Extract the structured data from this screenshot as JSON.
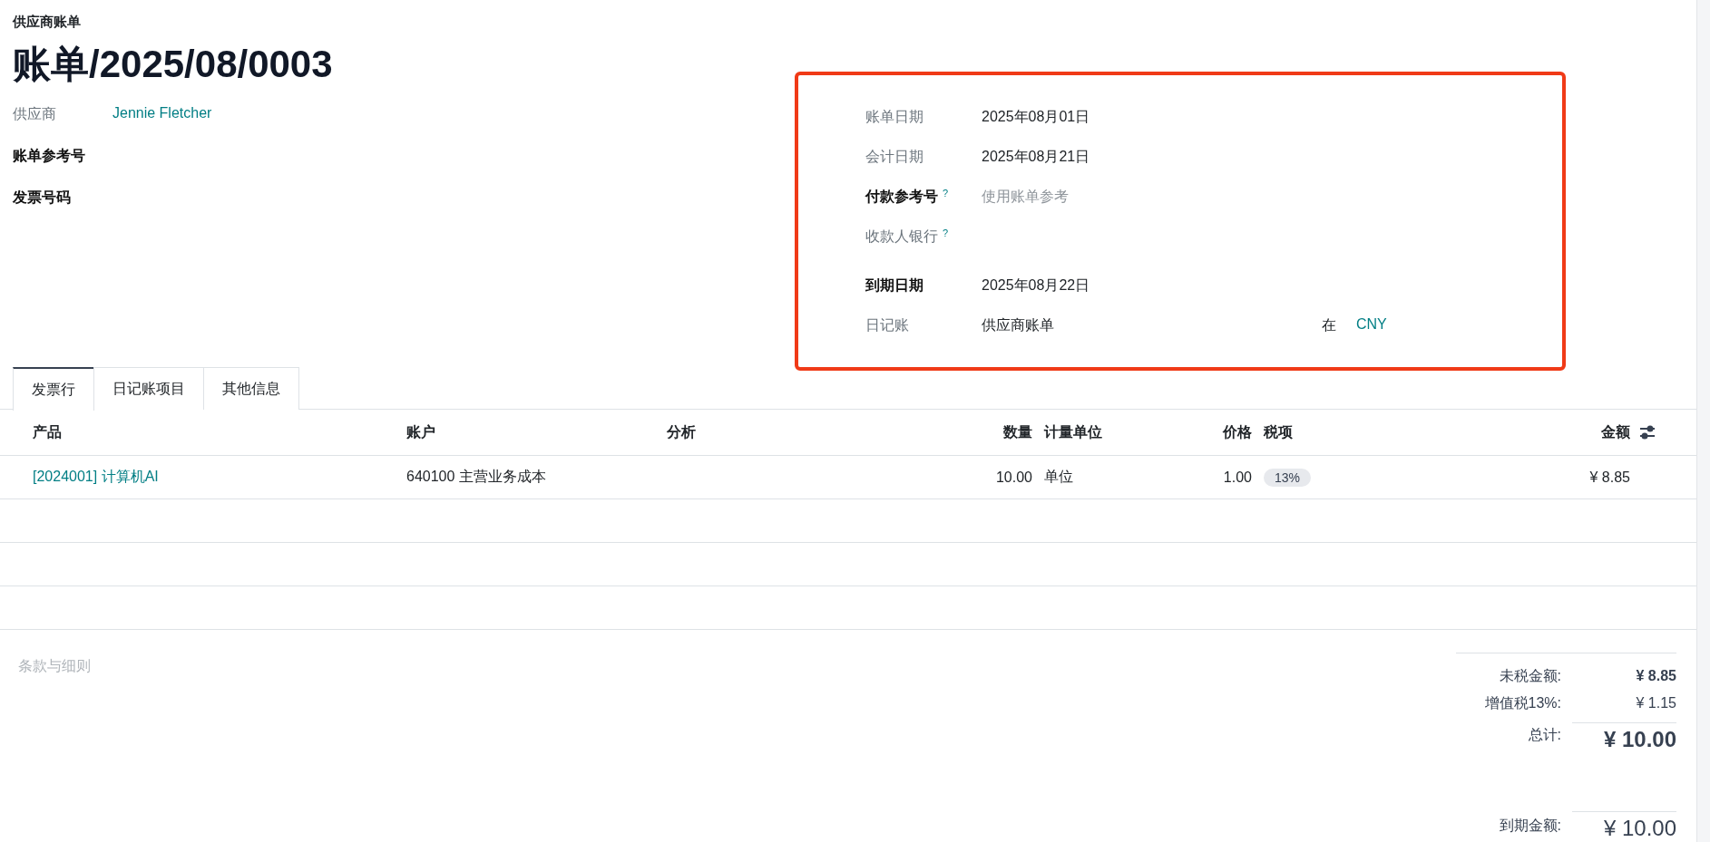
{
  "breadcrumb": "供应商账单",
  "title": "账单/2025/08/0003",
  "left_fields": [
    {
      "label": "供应商",
      "required": false,
      "kind": "link",
      "value": "Jennie Fletcher"
    },
    {
      "label": "账单参考号",
      "required": true,
      "kind": "empty"
    },
    {
      "label": "发票号码",
      "required": true,
      "kind": "empty"
    }
  ],
  "info_panel": {
    "highlighted": true,
    "fields": [
      {
        "label": "账单日期",
        "required": false,
        "kind": "text",
        "value": "2025年08月01日"
      },
      {
        "label": "会计日期",
        "required": false,
        "kind": "text",
        "value": "2025年08月21日"
      },
      {
        "label": "付款参考号",
        "required": true,
        "help": "?",
        "kind": "placeholder",
        "placeholder": "使用账单参考"
      },
      {
        "label": "收款人银行",
        "required": false,
        "help": "?",
        "kind": "empty"
      },
      {
        "label": "到期日期",
        "required": true,
        "kind": "text",
        "value": "2025年08月22日"
      },
      {
        "label": "日记账",
        "required": false,
        "kind": "journal",
        "value": "供应商账单",
        "currency_prefix": "在",
        "currency": "CNY"
      }
    ]
  },
  "tabs": [
    {
      "label": "发票行",
      "selected": true
    },
    {
      "label": "日记账项目",
      "selected": false
    },
    {
      "label": "其他信息",
      "selected": false
    }
  ],
  "table": {
    "columns": [
      {
        "label": "产品",
        "numeric": false
      },
      {
        "label": "账户",
        "numeric": false
      },
      {
        "label": "分析",
        "numeric": false
      },
      {
        "label": "数量",
        "numeric": true
      },
      {
        "label": "计量单位",
        "numeric": false
      },
      {
        "label": "价格",
        "numeric": true
      },
      {
        "label": "税项",
        "numeric": false
      },
      {
        "label": "金额",
        "numeric": true
      }
    ],
    "rows": [
      {
        "kind": "line",
        "cells": [
          {
            "kind": "link",
            "text": "[2024001] 计算机AI"
          },
          {
            "kind": "text",
            "text": "640100 主营业务成本"
          },
          {
            "kind": "empty"
          },
          {
            "kind": "number",
            "text": "10.00"
          },
          {
            "kind": "text",
            "text": "单位"
          },
          {
            "kind": "number",
            "text": "1.00"
          },
          {
            "kind": "tag",
            "text": "13%"
          },
          {
            "kind": "number",
            "text": "¥ 8.85"
          }
        ]
      },
      {
        "kind": "blank"
      },
      {
        "kind": "blank"
      },
      {
        "kind": "blank"
      }
    ]
  },
  "terms": {
    "placeholder": "条款与细则"
  },
  "totals": [
    {
      "kind": "subtotal",
      "label": "未税金额:",
      "value": "¥ 8.85"
    },
    {
      "kind": "tax",
      "label": "增值税13%:",
      "value": "¥ 1.15"
    },
    {
      "kind": "total",
      "label": "总计:",
      "value": "¥ 10.00"
    },
    {
      "kind": "due",
      "label": "到期金额:",
      "value": "¥ 10.00"
    }
  ]
}
